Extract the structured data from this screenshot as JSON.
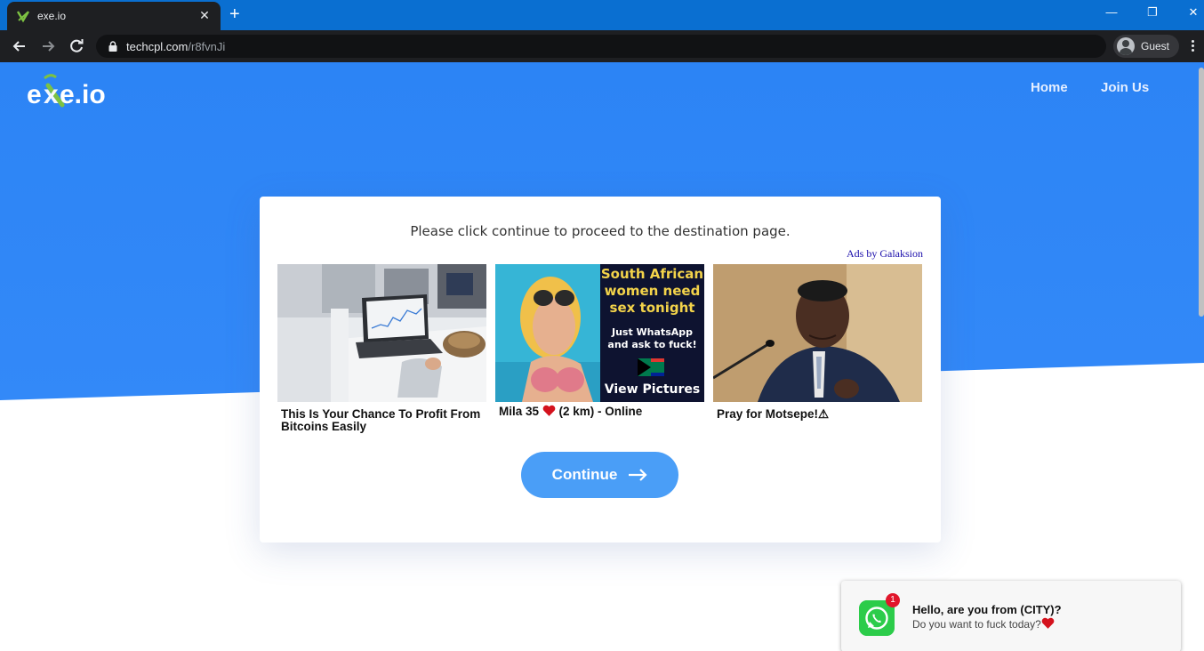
{
  "browser": {
    "tab_title": "exe.io",
    "new_tab": "+",
    "url_host": "techcpl.com",
    "url_path": "/r8fvnJi",
    "profile_label": "Guest"
  },
  "site": {
    "logo_text": "exe.io",
    "nav": [
      {
        "label": "Home"
      },
      {
        "label": "Join Us"
      }
    ]
  },
  "card": {
    "instruction": "Please click continue to proceed to the destination page.",
    "ads_by": "Ads by Galaksion",
    "ads": [
      {
        "caption": "This Is Your Chance To Profit From Bitcoins Easily"
      },
      {
        "caption_before": "Mila 35 ",
        "caption_after": " (2 km) - Online",
        "banner_line1": "South African",
        "banner_line2": "women need",
        "banner_line3": "sex tonight",
        "banner_line4": "Just WhatsApp",
        "banner_line5": "and ask to fuck!",
        "banner_cta": "View Pictures"
      },
      {
        "caption": "Pray for Motsepe!⚠"
      }
    ],
    "continue_label": "Continue"
  },
  "notification": {
    "badge": "1",
    "title": "Hello, are you from (CITY)?",
    "body": "Do you want to fuck today?"
  },
  "colors": {
    "brand_blue": "#2f86f7",
    "button_blue": "#4a9ef7",
    "whatsapp_green": "#2ccc4a"
  }
}
